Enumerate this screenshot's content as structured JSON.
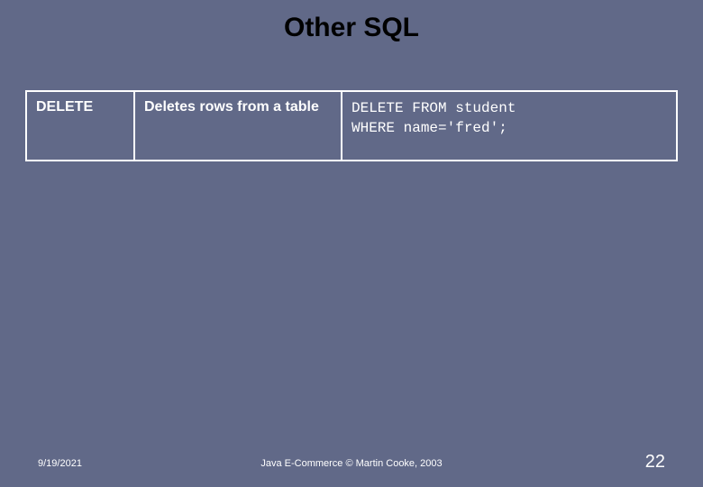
{
  "title": "Other SQL",
  "table": {
    "rows": [
      {
        "command": "DELETE",
        "description": "Deletes rows from a table",
        "code": "DELETE FROM student\nWHERE name='fred';"
      }
    ]
  },
  "footer": {
    "date": "9/19/2021",
    "center": "Java E-Commerce © Martin Cooke, 2003",
    "page": "22"
  }
}
